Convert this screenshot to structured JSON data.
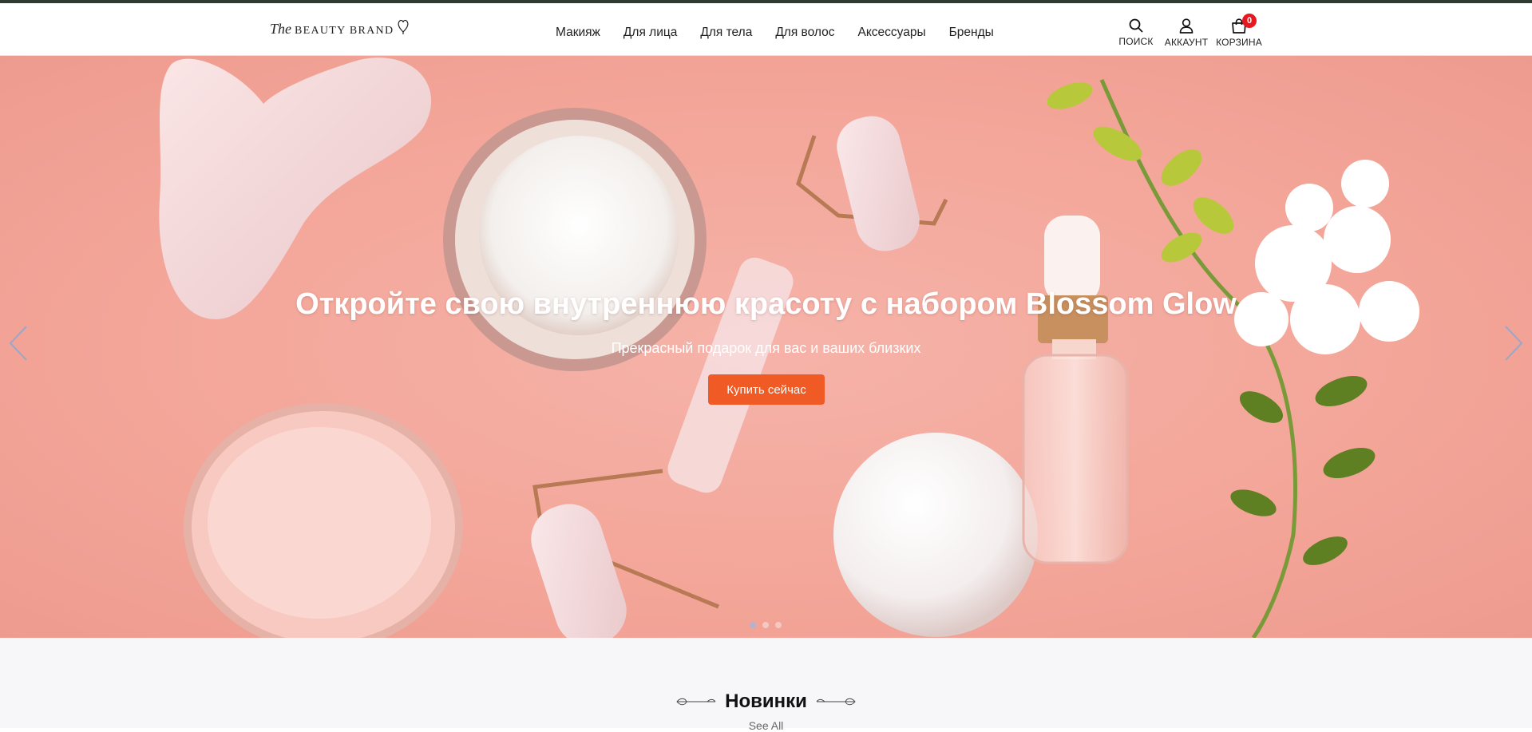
{
  "header": {
    "logo": {
      "the": "The",
      "brand": "BEAUTY BRAND"
    },
    "nav": [
      {
        "label": "Макияж"
      },
      {
        "label": "Для лица"
      },
      {
        "label": "Для тела"
      },
      {
        "label": "Для волос"
      },
      {
        "label": "Аксессуары"
      },
      {
        "label": "Бренды"
      }
    ],
    "actions": {
      "search_label": "ПОИСК",
      "account_label": "АККАУНТ",
      "cart_label": "КОРЗИНА",
      "cart_count": "0"
    }
  },
  "hero": {
    "title": "Откройте свою внутреннюю красоту с набором Blossom Glow",
    "subtitle": "Прекрасный подарок для вас и ваших близких",
    "button_label": "Купить сейчас",
    "slide_count": 3,
    "active_slide": 1
  },
  "section": {
    "title": "Новинки",
    "link_label": "See All"
  },
  "colors": {
    "accent": "#f05a24",
    "topbar": "#2f3a30",
    "hero_bg": "#f3a598",
    "cart_badge": "#e6191e"
  },
  "icons": [
    "search-icon",
    "user-icon",
    "shopping-bag-icon",
    "chevron-left-icon",
    "chevron-right-icon",
    "heart-icon"
  ]
}
